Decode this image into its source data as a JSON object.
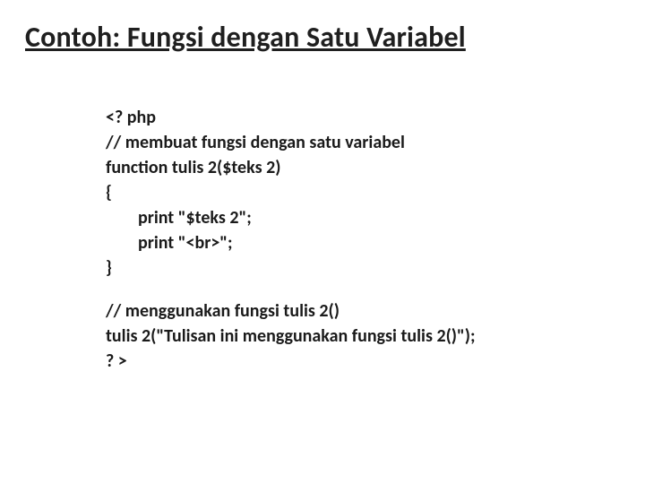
{
  "title": "Contoh: Fungsi dengan Satu Variabel",
  "code": {
    "l1": "<? php",
    "l2": "// membuat fungsi dengan satu variabel",
    "l3": "function tulis 2($teks 2)",
    "l4": "{",
    "l5": "print \"$teks 2\";",
    "l6": "print \"<br>\";",
    "l7": "}",
    "l8": "// menggunakan fungsi tulis 2()",
    "l9": "tulis 2(\"Tulisan ini menggunakan fungsi tulis 2()\");",
    "l10": "? >"
  }
}
